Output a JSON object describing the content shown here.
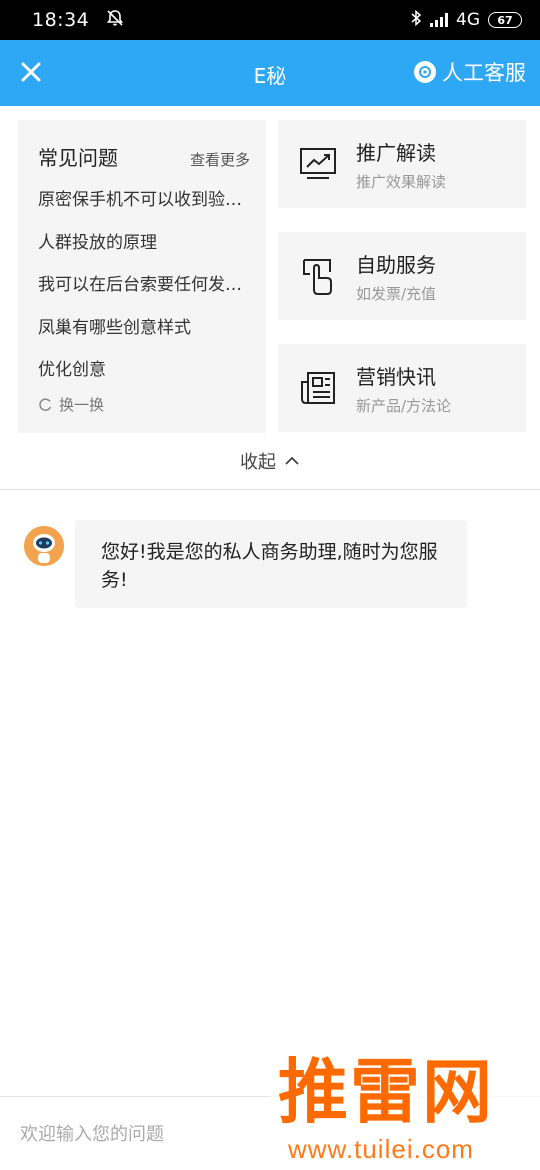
{
  "status_bar": {
    "time": "18:34",
    "network": "4G",
    "battery": "67"
  },
  "header": {
    "title": "E秘",
    "service_label": "人工客服"
  },
  "faq": {
    "title": "常见问题",
    "more_label": "查看更多",
    "items": [
      "原密保手机不可以收到验证码怎么办",
      "人群投放的原理",
      "我可以在后台索要任何发票吗",
      "凤巢有哪些创意样式",
      "优化创意"
    ],
    "refresh_label": "换一换"
  },
  "features": [
    {
      "title": "推广解读",
      "subtitle": "推广效果解读",
      "icon": "trend-chart-icon"
    },
    {
      "title": "自助服务",
      "subtitle": "如发票/充值",
      "icon": "tap-hand-icon"
    },
    {
      "title": "营销快讯",
      "subtitle": "新产品/方法论",
      "icon": "newspaper-icon"
    }
  ],
  "collapse_label": "收起",
  "chat": {
    "messages": [
      {
        "from": "bot",
        "text": "您好!我是您的私人商务助理,随时为您服务!"
      }
    ]
  },
  "input": {
    "placeholder": "欢迎输入您的问题"
  },
  "watermark": {
    "brand": "推雷网",
    "url": "www.tuilei.com"
  },
  "colors": {
    "header_bg": "#2ea7f4",
    "card_bg": "#f5f5f5",
    "watermark": "#ff6a00"
  }
}
